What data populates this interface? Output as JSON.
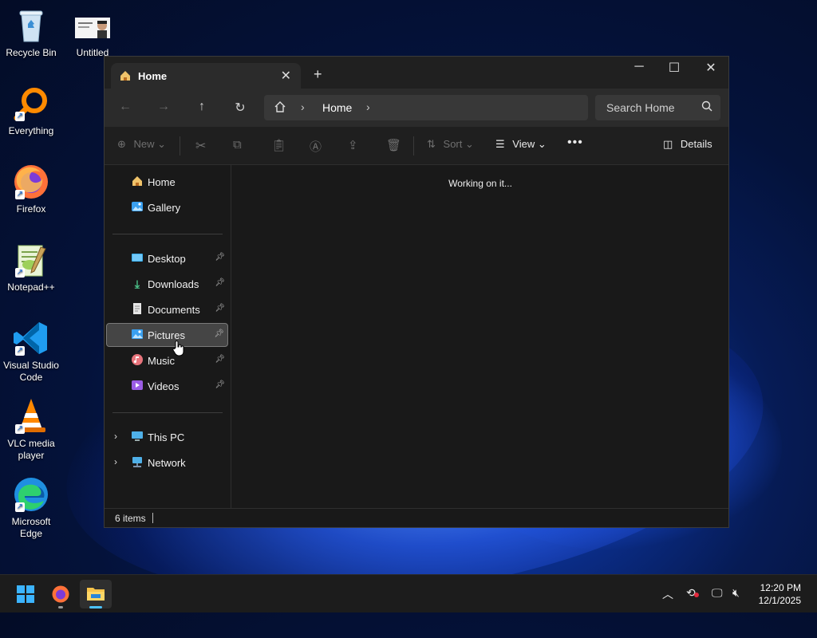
{
  "desktop": {
    "icons": [
      {
        "label": "Recycle Bin",
        "icon": "recycle-bin-icon"
      },
      {
        "label": "Untitled",
        "icon": "image-thumbnail-icon"
      },
      {
        "label": "Everything",
        "icon": "everything-search-icon"
      },
      {
        "label": "Firefox",
        "icon": "firefox-icon"
      },
      {
        "label": "Notepad++",
        "icon": "notepadpp-icon"
      },
      {
        "label": "Visual Studio Code",
        "icon": "vscode-icon"
      },
      {
        "label": "VLC media player",
        "icon": "vlc-icon"
      },
      {
        "label": "Microsoft Edge",
        "icon": "edge-icon"
      }
    ]
  },
  "explorer": {
    "tab_title": "Home",
    "breadcrumb": "Home",
    "search_placeholder": "Search Home",
    "commands": {
      "new": "New",
      "sort": "Sort",
      "view": "View",
      "details": "Details"
    },
    "sidebar": {
      "top": [
        {
          "label": "Home",
          "icon": "home-icon"
        },
        {
          "label": "Gallery",
          "icon": "gallery-icon"
        }
      ],
      "quick_access": [
        {
          "label": "Desktop",
          "icon": "desktop-folder-icon"
        },
        {
          "label": "Downloads",
          "icon": "downloads-icon"
        },
        {
          "label": "Documents",
          "icon": "documents-icon"
        },
        {
          "label": "Pictures",
          "icon": "pictures-icon",
          "selected": true
        },
        {
          "label": "Music",
          "icon": "music-icon"
        },
        {
          "label": "Videos",
          "icon": "videos-icon"
        }
      ],
      "bottom": [
        {
          "label": "This PC",
          "icon": "this-pc-icon"
        },
        {
          "label": "Network",
          "icon": "network-icon"
        }
      ]
    },
    "main_message": "Working on it...",
    "status": "6 items"
  },
  "taskbar": {
    "time": "12:20 PM",
    "date": "12/1/2025"
  },
  "colors": {
    "window_bg": "#191919",
    "accent": "#0078d4"
  }
}
